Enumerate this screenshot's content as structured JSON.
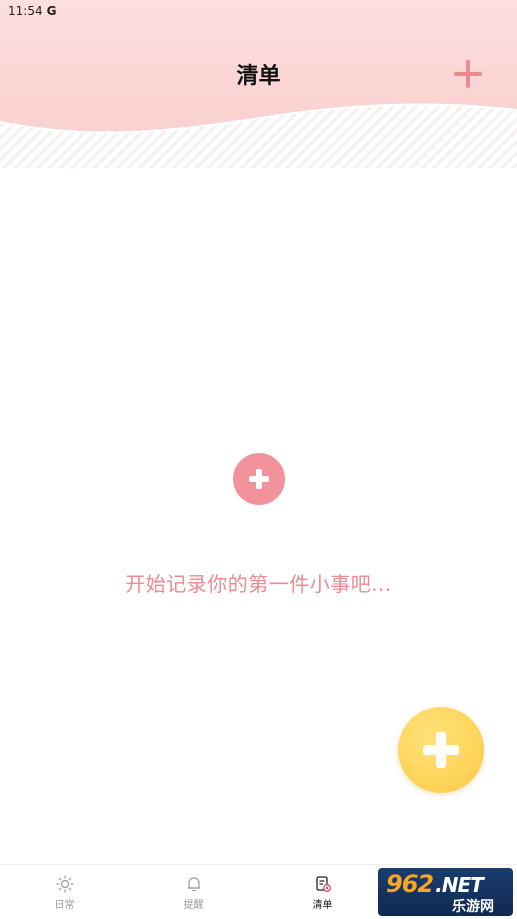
{
  "status_bar": {
    "time": "11:54",
    "g_letter": "G"
  },
  "header": {
    "title": "清单",
    "add_icon": "plus-icon"
  },
  "empty_state": {
    "message": "开始记录你的第一件小事吧...",
    "icon": "plus-circle-icon"
  },
  "fab": {
    "icon": "plus-icon"
  },
  "tabs": [
    {
      "label": "日常",
      "icon": "sun-icon",
      "active": false
    },
    {
      "label": "提醒",
      "icon": "bell-icon",
      "active": false
    },
    {
      "label": "清单",
      "icon": "checklist-icon",
      "active": true
    }
  ],
  "watermark": {
    "main": "962",
    "suffix": ".NET",
    "sub": "乐游网"
  },
  "colors": {
    "header_pink": "#fbd3d3",
    "accent_pink": "#ee8a8f",
    "fab_yellow": "#fdd45a"
  }
}
